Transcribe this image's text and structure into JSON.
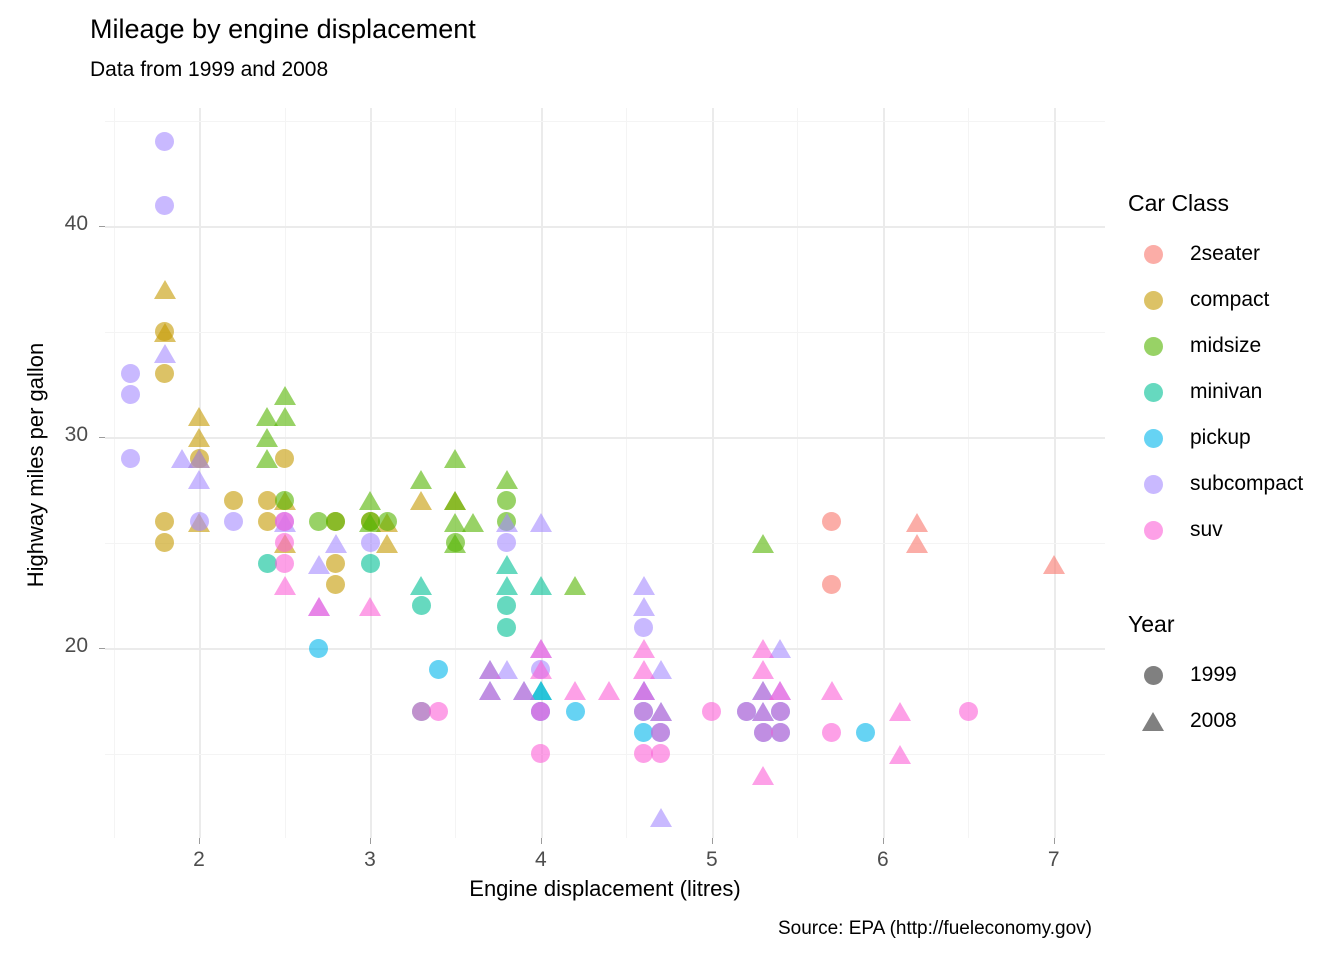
{
  "title": "Mileage by engine displacement",
  "subtitle": "Data from 1999 and 2008",
  "caption": "Source: EPA (http://fueleconomy.gov)",
  "legend": {
    "color_title": "Car Class",
    "shape_title": "Year",
    "classes": [
      {
        "label": "2seater",
        "color": "#F8766D"
      },
      {
        "label": "compact",
        "color": "#C49A00"
      },
      {
        "label": "midsize",
        "color": "#53B400"
      },
      {
        "label": "minivan",
        "color": "#00C094"
      },
      {
        "label": "pickup",
        "color": "#00B6EB"
      },
      {
        "label": "subcompact",
        "color": "#A58AFF"
      },
      {
        "label": "suv",
        "color": "#FB61D7"
      }
    ],
    "years": [
      {
        "label": "1999",
        "shape": "circle",
        "color": "#808080"
      },
      {
        "label": "2008",
        "shape": "triangle",
        "color": "#808080"
      }
    ]
  },
  "chart_data": {
    "type": "scatter",
    "title": "Mileage by engine displacement",
    "subtitle": "Data from 1999 and 2008",
    "caption": "Source: EPA (http://fueleconomy.gov)",
    "xlabel": "Engine displacement (litres)",
    "ylabel": "Highway miles per gallon",
    "xlim": [
      1.45,
      7.3
    ],
    "ylim": [
      11.0,
      45.6
    ],
    "xticks": [
      2,
      3,
      4,
      5,
      6,
      7
    ],
    "yticks": [
      20,
      30,
      40
    ],
    "grid": true,
    "legend_position": "right",
    "color_by": "class",
    "shape_by": "year",
    "alpha": 0.6,
    "point_size": 19,
    "series": [
      {
        "name": "2seater",
        "color": "#F8766D",
        "points": [
          {
            "x": 5.7,
            "y": 26,
            "year": 1999
          },
          {
            "x": 5.7,
            "y": 23,
            "year": 1999
          },
          {
            "x": 6.2,
            "y": 26,
            "year": 2008
          },
          {
            "x": 6.2,
            "y": 25,
            "year": 2008
          },
          {
            "x": 7.0,
            "y": 24,
            "year": 2008
          }
        ]
      },
      {
        "name": "compact",
        "color": "#C49A00",
        "points": [
          {
            "x": 1.8,
            "y": 37,
            "year": 2008
          },
          {
            "x": 1.8,
            "y": 35,
            "year": 1999
          },
          {
            "x": 1.8,
            "y": 33,
            "year": 1999
          },
          {
            "x": 1.8,
            "y": 35,
            "year": 2008
          },
          {
            "x": 1.8,
            "y": 26,
            "year": 1999
          },
          {
            "x": 1.8,
            "y": 25,
            "year": 1999
          },
          {
            "x": 2.0,
            "y": 31,
            "year": 2008
          },
          {
            "x": 2.0,
            "y": 30,
            "year": 2008
          },
          {
            "x": 2.0,
            "y": 29,
            "year": 1999
          },
          {
            "x": 2.0,
            "y": 29,
            "year": 2008
          },
          {
            "x": 2.0,
            "y": 26,
            "year": 2008
          },
          {
            "x": 2.2,
            "y": 27,
            "year": 1999
          },
          {
            "x": 2.4,
            "y": 27,
            "year": 1999
          },
          {
            "x": 2.4,
            "y": 26,
            "year": 1999
          },
          {
            "x": 2.5,
            "y": 29,
            "year": 1999
          },
          {
            "x": 2.5,
            "y": 27,
            "year": 2008
          },
          {
            "x": 2.5,
            "y": 25,
            "year": 2008
          },
          {
            "x": 2.8,
            "y": 26,
            "year": 1999
          },
          {
            "x": 2.8,
            "y": 24,
            "year": 1999
          },
          {
            "x": 2.8,
            "y": 23,
            "year": 1999
          },
          {
            "x": 3.0,
            "y": 26,
            "year": 1999
          },
          {
            "x": 3.1,
            "y": 26,
            "year": 2008
          },
          {
            "x": 3.1,
            "y": 25,
            "year": 2008
          },
          {
            "x": 3.3,
            "y": 27,
            "year": 2008
          },
          {
            "x": 3.5,
            "y": 27,
            "year": 2008
          }
        ]
      },
      {
        "name": "midsize",
        "color": "#53B400",
        "points": [
          {
            "x": 2.4,
            "y": 31,
            "year": 2008
          },
          {
            "x": 2.4,
            "y": 30,
            "year": 2008
          },
          {
            "x": 2.4,
            "y": 29,
            "year": 2008
          },
          {
            "x": 2.5,
            "y": 32,
            "year": 2008
          },
          {
            "x": 2.5,
            "y": 31,
            "year": 2008
          },
          {
            "x": 2.5,
            "y": 27,
            "year": 1999
          },
          {
            "x": 2.7,
            "y": 26,
            "year": 1999
          },
          {
            "x": 2.8,
            "y": 26,
            "year": 1999
          },
          {
            "x": 3.0,
            "y": 27,
            "year": 2008
          },
          {
            "x": 3.0,
            "y": 26,
            "year": 1999
          },
          {
            "x": 3.0,
            "y": 26,
            "year": 2008
          },
          {
            "x": 3.1,
            "y": 26,
            "year": 1999
          },
          {
            "x": 3.3,
            "y": 28,
            "year": 2008
          },
          {
            "x": 3.5,
            "y": 29,
            "year": 2008
          },
          {
            "x": 3.5,
            "y": 27,
            "year": 2008
          },
          {
            "x": 3.5,
            "y": 26,
            "year": 2008
          },
          {
            "x": 3.5,
            "y": 25,
            "year": 2008
          },
          {
            "x": 3.5,
            "y": 25,
            "year": 1999
          },
          {
            "x": 3.6,
            "y": 26,
            "year": 2008
          },
          {
            "x": 3.8,
            "y": 28,
            "year": 2008
          },
          {
            "x": 3.8,
            "y": 27,
            "year": 1999
          },
          {
            "x": 3.8,
            "y": 26,
            "year": 1999
          },
          {
            "x": 4.2,
            "y": 23,
            "year": 2008
          },
          {
            "x": 5.3,
            "y": 25,
            "year": 2008
          }
        ]
      },
      {
        "name": "minivan",
        "color": "#00C094",
        "points": [
          {
            "x": 2.4,
            "y": 24,
            "year": 1999
          },
          {
            "x": 3.0,
            "y": 24,
            "year": 1999
          },
          {
            "x": 3.3,
            "y": 22,
            "year": 1999
          },
          {
            "x": 3.3,
            "y": 17,
            "year": 1999
          },
          {
            "x": 3.8,
            "y": 24,
            "year": 2008
          },
          {
            "x": 3.8,
            "y": 23,
            "year": 2008
          },
          {
            "x": 3.8,
            "y": 22,
            "year": 1999
          },
          {
            "x": 3.8,
            "y": 21,
            "year": 1999
          },
          {
            "x": 3.3,
            "y": 23,
            "year": 2008
          },
          {
            "x": 4.0,
            "y": 23,
            "year": 2008
          },
          {
            "x": 4.0,
            "y": 18,
            "year": 2008
          }
        ]
      },
      {
        "name": "pickup",
        "color": "#00B6EB",
        "points": [
          {
            "x": 2.7,
            "y": 20,
            "year": 1999
          },
          {
            "x": 3.4,
            "y": 19,
            "year": 1999
          },
          {
            "x": 3.7,
            "y": 19,
            "year": 2008
          },
          {
            "x": 3.7,
            "y": 18,
            "year": 2008
          },
          {
            "x": 3.9,
            "y": 18,
            "year": 2008
          },
          {
            "x": 4.0,
            "y": 18,
            "year": 2008
          },
          {
            "x": 4.0,
            "y": 17,
            "year": 1999
          },
          {
            "x": 4.2,
            "y": 17,
            "year": 1999
          },
          {
            "x": 4.6,
            "y": 18,
            "year": 2008
          },
          {
            "x": 4.6,
            "y": 17,
            "year": 1999
          },
          {
            "x": 4.6,
            "y": 16,
            "year": 1999
          },
          {
            "x": 4.7,
            "y": 17,
            "year": 2008
          },
          {
            "x": 4.7,
            "y": 16,
            "year": 1999
          },
          {
            "x": 5.2,
            "y": 17,
            "year": 1999
          },
          {
            "x": 5.3,
            "y": 18,
            "year": 2008
          },
          {
            "x": 5.3,
            "y": 17,
            "year": 2008
          },
          {
            "x": 5.3,
            "y": 16,
            "year": 1999
          },
          {
            "x": 5.4,
            "y": 17,
            "year": 1999
          },
          {
            "x": 5.4,
            "y": 16,
            "year": 1999
          },
          {
            "x": 5.9,
            "y": 16,
            "year": 1999
          }
        ]
      },
      {
        "name": "subcompact",
        "color": "#A58AFF",
        "points": [
          {
            "x": 1.6,
            "y": 33,
            "year": 1999
          },
          {
            "x": 1.6,
            "y": 32,
            "year": 1999
          },
          {
            "x": 1.6,
            "y": 29,
            "year": 1999
          },
          {
            "x": 1.8,
            "y": 44,
            "year": 1999
          },
          {
            "x": 1.8,
            "y": 41,
            "year": 1999
          },
          {
            "x": 1.8,
            "y": 34,
            "year": 2008
          },
          {
            "x": 1.9,
            "y": 29,
            "year": 2008
          },
          {
            "x": 2.0,
            "y": 29,
            "year": 2008
          },
          {
            "x": 2.0,
            "y": 28,
            "year": 2008
          },
          {
            "x": 2.0,
            "y": 26,
            "year": 1999
          },
          {
            "x": 2.2,
            "y": 26,
            "year": 1999
          },
          {
            "x": 2.5,
            "y": 26,
            "year": 1999
          },
          {
            "x": 2.5,
            "y": 26,
            "year": 2008
          },
          {
            "x": 2.7,
            "y": 24,
            "year": 2008
          },
          {
            "x": 2.7,
            "y": 22,
            "year": 2008
          },
          {
            "x": 2.8,
            "y": 25,
            "year": 2008
          },
          {
            "x": 3.0,
            "y": 25,
            "year": 1999
          },
          {
            "x": 3.8,
            "y": 26,
            "year": 2008
          },
          {
            "x": 3.8,
            "y": 25,
            "year": 1999
          },
          {
            "x": 3.8,
            "y": 19,
            "year": 2008
          },
          {
            "x": 4.0,
            "y": 26,
            "year": 2008
          },
          {
            "x": 4.0,
            "y": 20,
            "year": 2008
          },
          {
            "x": 4.0,
            "y": 19,
            "year": 1999
          },
          {
            "x": 4.0,
            "y": 17,
            "year": 1999
          },
          {
            "x": 4.6,
            "y": 23,
            "year": 2008
          },
          {
            "x": 4.6,
            "y": 22,
            "year": 2008
          },
          {
            "x": 4.6,
            "y": 21,
            "year": 1999
          },
          {
            "x": 4.6,
            "y": 18,
            "year": 2008
          },
          {
            "x": 4.7,
            "y": 19,
            "year": 2008
          },
          {
            "x": 4.7,
            "y": 12,
            "year": 2008
          },
          {
            "x": 5.4,
            "y": 20,
            "year": 2008
          },
          {
            "x": 5.4,
            "y": 18,
            "year": 2008
          }
        ]
      },
      {
        "name": "suv",
        "color": "#FB61D7",
        "points": [
          {
            "x": 2.5,
            "y": 23,
            "year": 2008
          },
          {
            "x": 2.5,
            "y": 26,
            "year": 1999
          },
          {
            "x": 2.5,
            "y": 25,
            "year": 1999
          },
          {
            "x": 2.5,
            "y": 24,
            "year": 1999
          },
          {
            "x": 2.7,
            "y": 22,
            "year": 2008
          },
          {
            "x": 3.0,
            "y": 22,
            "year": 2008
          },
          {
            "x": 3.3,
            "y": 17,
            "year": 1999
          },
          {
            "x": 3.4,
            "y": 17,
            "year": 1999
          },
          {
            "x": 3.7,
            "y": 19,
            "year": 2008
          },
          {
            "x": 3.7,
            "y": 18,
            "year": 2008
          },
          {
            "x": 3.9,
            "y": 18,
            "year": 2008
          },
          {
            "x": 4.0,
            "y": 20,
            "year": 2008
          },
          {
            "x": 4.0,
            "y": 19,
            "year": 2008
          },
          {
            "x": 4.0,
            "y": 17,
            "year": 1999
          },
          {
            "x": 4.0,
            "y": 15,
            "year": 1999
          },
          {
            "x": 4.2,
            "y": 18,
            "year": 2008
          },
          {
            "x": 4.4,
            "y": 18,
            "year": 2008
          },
          {
            "x": 4.6,
            "y": 20,
            "year": 2008
          },
          {
            "x": 4.6,
            "y": 19,
            "year": 2008
          },
          {
            "x": 4.6,
            "y": 18,
            "year": 2008
          },
          {
            "x": 4.6,
            "y": 17,
            "year": 1999
          },
          {
            "x": 4.6,
            "y": 15,
            "year": 1999
          },
          {
            "x": 4.7,
            "y": 17,
            "year": 2008
          },
          {
            "x": 4.7,
            "y": 16,
            "year": 1999
          },
          {
            "x": 4.7,
            "y": 15,
            "year": 1999
          },
          {
            "x": 5.0,
            "y": 17,
            "year": 1999
          },
          {
            "x": 5.2,
            "y": 17,
            "year": 1999
          },
          {
            "x": 5.3,
            "y": 20,
            "year": 2008
          },
          {
            "x": 5.3,
            "y": 19,
            "year": 2008
          },
          {
            "x": 5.3,
            "y": 18,
            "year": 2008
          },
          {
            "x": 5.3,
            "y": 17,
            "year": 2008
          },
          {
            "x": 5.3,
            "y": 16,
            "year": 1999
          },
          {
            "x": 5.3,
            "y": 14,
            "year": 2008
          },
          {
            "x": 5.4,
            "y": 18,
            "year": 2008
          },
          {
            "x": 5.4,
            "y": 17,
            "year": 1999
          },
          {
            "x": 5.4,
            "y": 16,
            "year": 1999
          },
          {
            "x": 5.7,
            "y": 18,
            "year": 2008
          },
          {
            "x": 5.7,
            "y": 16,
            "year": 1999
          },
          {
            "x": 6.1,
            "y": 17,
            "year": 2008
          },
          {
            "x": 6.1,
            "y": 15,
            "year": 2008
          },
          {
            "x": 6.5,
            "y": 17,
            "year": 1999
          }
        ]
      }
    ]
  }
}
